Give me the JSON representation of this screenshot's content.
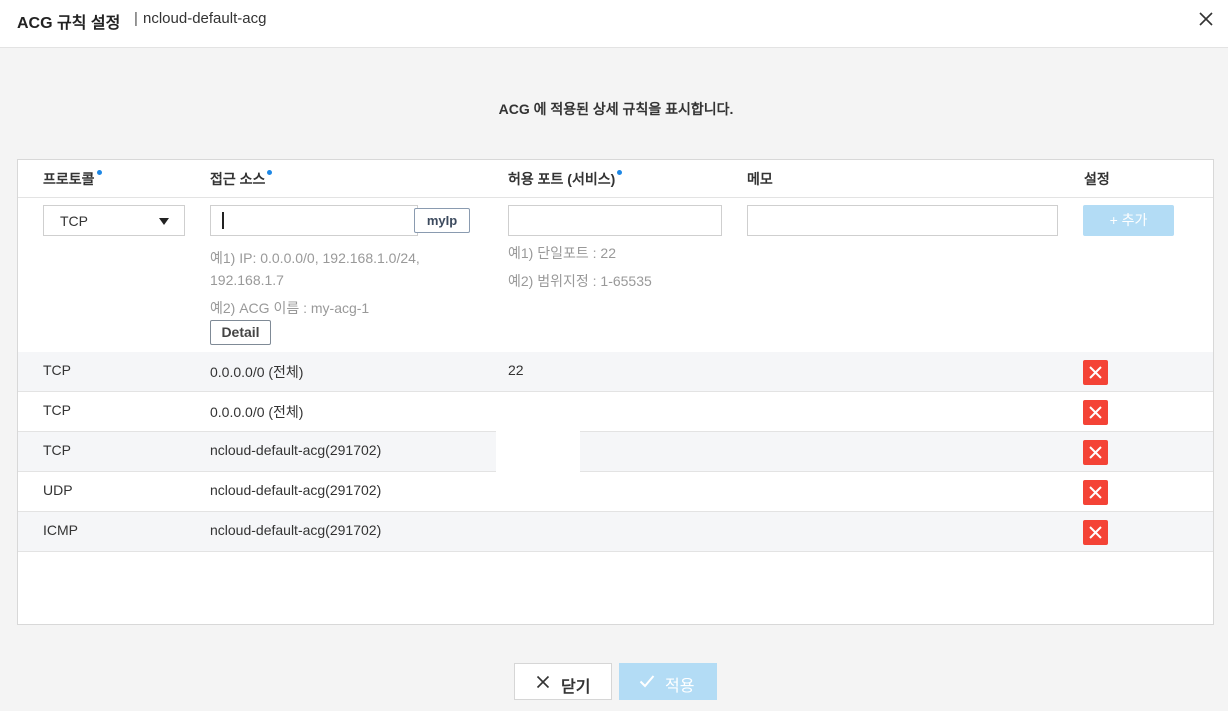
{
  "header": {
    "title": "ACG 규칙 설정",
    "separator": "|",
    "subtitle": "ncloud-default-acg"
  },
  "description": "ACG 에 적용된 상세 규칙을 표시합니다.",
  "table": {
    "headers": {
      "protocol": "프로토콜",
      "source": "접근 소스",
      "port": "허용 포트 (서비스)",
      "memo": "메모",
      "settings": "설정"
    },
    "form": {
      "protocol_selected": "TCP",
      "source_value": "",
      "myip_label": "myIp",
      "source_hint1": "예1) IP: 0.0.0.0/0, 192.168.1.0/24,",
      "source_hint1b": "192.168.1.7",
      "source_hint2": "예2) ACG 이름 : my-acg-1",
      "detail_label": "Detail",
      "port_value": "",
      "port_hint1": "예1) 단일포트 : 22",
      "port_hint2": "예2) 범위지정 : 1-65535",
      "memo_value": "",
      "add_label": "+ 추가"
    },
    "rows": [
      {
        "protocol": "TCP",
        "source": "0.0.0.0/0 (전체)",
        "port": "22",
        "memo": ""
      },
      {
        "protocol": "TCP",
        "source": "0.0.0.0/0 (전체)",
        "port": "",
        "memo": ""
      },
      {
        "protocol": "TCP",
        "source": "ncloud-default-acg(291702)",
        "port": "",
        "memo": ""
      },
      {
        "protocol": "UDP",
        "source": "ncloud-default-acg(291702)",
        "port": "",
        "memo": ""
      },
      {
        "protocol": "ICMP",
        "source": "ncloud-default-acg(291702)",
        "port": "",
        "memo": ""
      }
    ]
  },
  "footer": {
    "close_label": "닫기",
    "apply_label": "적용"
  },
  "colors": {
    "accent": "#1e88e5",
    "delete": "#f44336",
    "disabled_button": "#b3dcf5"
  }
}
